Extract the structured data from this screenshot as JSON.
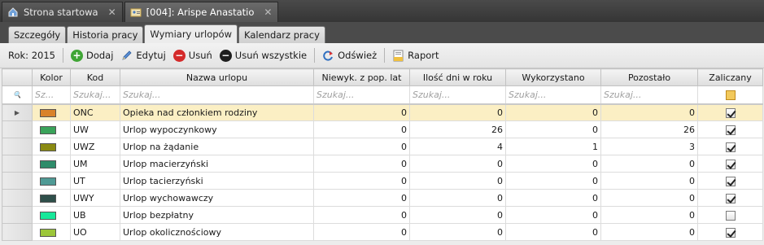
{
  "doc_tabs": [
    {
      "label": "Strona startowa",
      "icon": "home-icon",
      "active": false
    },
    {
      "label": "[004]: Arispe Anastatio",
      "icon": "id-card-icon",
      "active": true
    }
  ],
  "sub_tabs": [
    {
      "label": "Szczegóły",
      "active": false
    },
    {
      "label": "Historia pracy",
      "active": false
    },
    {
      "label": "Wymiary urlopów",
      "active": true
    },
    {
      "label": "Kalendarz pracy",
      "active": false
    }
  ],
  "toolbar": {
    "year_label": "Rok: 2015",
    "add_label": "Dodaj",
    "edit_label": "Edytuj",
    "delete_label": "Usuń",
    "delete_all_label": "Usuń wszystkie",
    "refresh_label": "Odśwież",
    "report_label": "Raport"
  },
  "columns": [
    "Kolor",
    "Kod",
    "Nazwa urlopu",
    "Niewyk. z pop. lat",
    "Ilość dni w roku",
    "Wykorzystano",
    "Pozostało",
    "Zaliczany"
  ],
  "filter": {
    "placeholder_short": "Sz...",
    "placeholder": "Szukaj...",
    "placeholder_mid": "Szukaj..."
  },
  "rows": [
    {
      "color": "#d9822b",
      "code": "ONC",
      "name": "Opieka nad członkiem rodziny",
      "carry": "0",
      "days": "0",
      "used": "0",
      "left": "0",
      "counted": true
    },
    {
      "color": "#3aa35a",
      "code": "UW",
      "name": "Urlop wypoczynkowy",
      "carry": "0",
      "days": "26",
      "used": "0",
      "left": "26",
      "counted": true
    },
    {
      "color": "#8a8a12",
      "code": "UWZ",
      "name": "Urlop na żądanie",
      "carry": "0",
      "days": "4",
      "used": "1",
      "left": "3",
      "counted": true
    },
    {
      "color": "#2e8c6a",
      "code": "UM",
      "name": "Urlop macierzyński",
      "carry": "0",
      "days": "0",
      "used": "0",
      "left": "0",
      "counted": true
    },
    {
      "color": "#4f9a95",
      "code": "UT",
      "name": "Urlop tacierzyński",
      "carry": "0",
      "days": "0",
      "used": "0",
      "left": "0",
      "counted": true
    },
    {
      "color": "#2f4f4a",
      "code": "UWY",
      "name": "Urlop wychowawczy",
      "carry": "0",
      "days": "0",
      "used": "0",
      "left": "0",
      "counted": true
    },
    {
      "color": "#17e89a",
      "code": "UB",
      "name": "Urlop bezpłatny",
      "carry": "0",
      "days": "0",
      "used": "0",
      "left": "0",
      "counted": false
    },
    {
      "color": "#9cc63a",
      "code": "UO",
      "name": "Urlop okolicznościowy",
      "carry": "0",
      "days": "0",
      "used": "0",
      "left": "0",
      "counted": true
    }
  ]
}
